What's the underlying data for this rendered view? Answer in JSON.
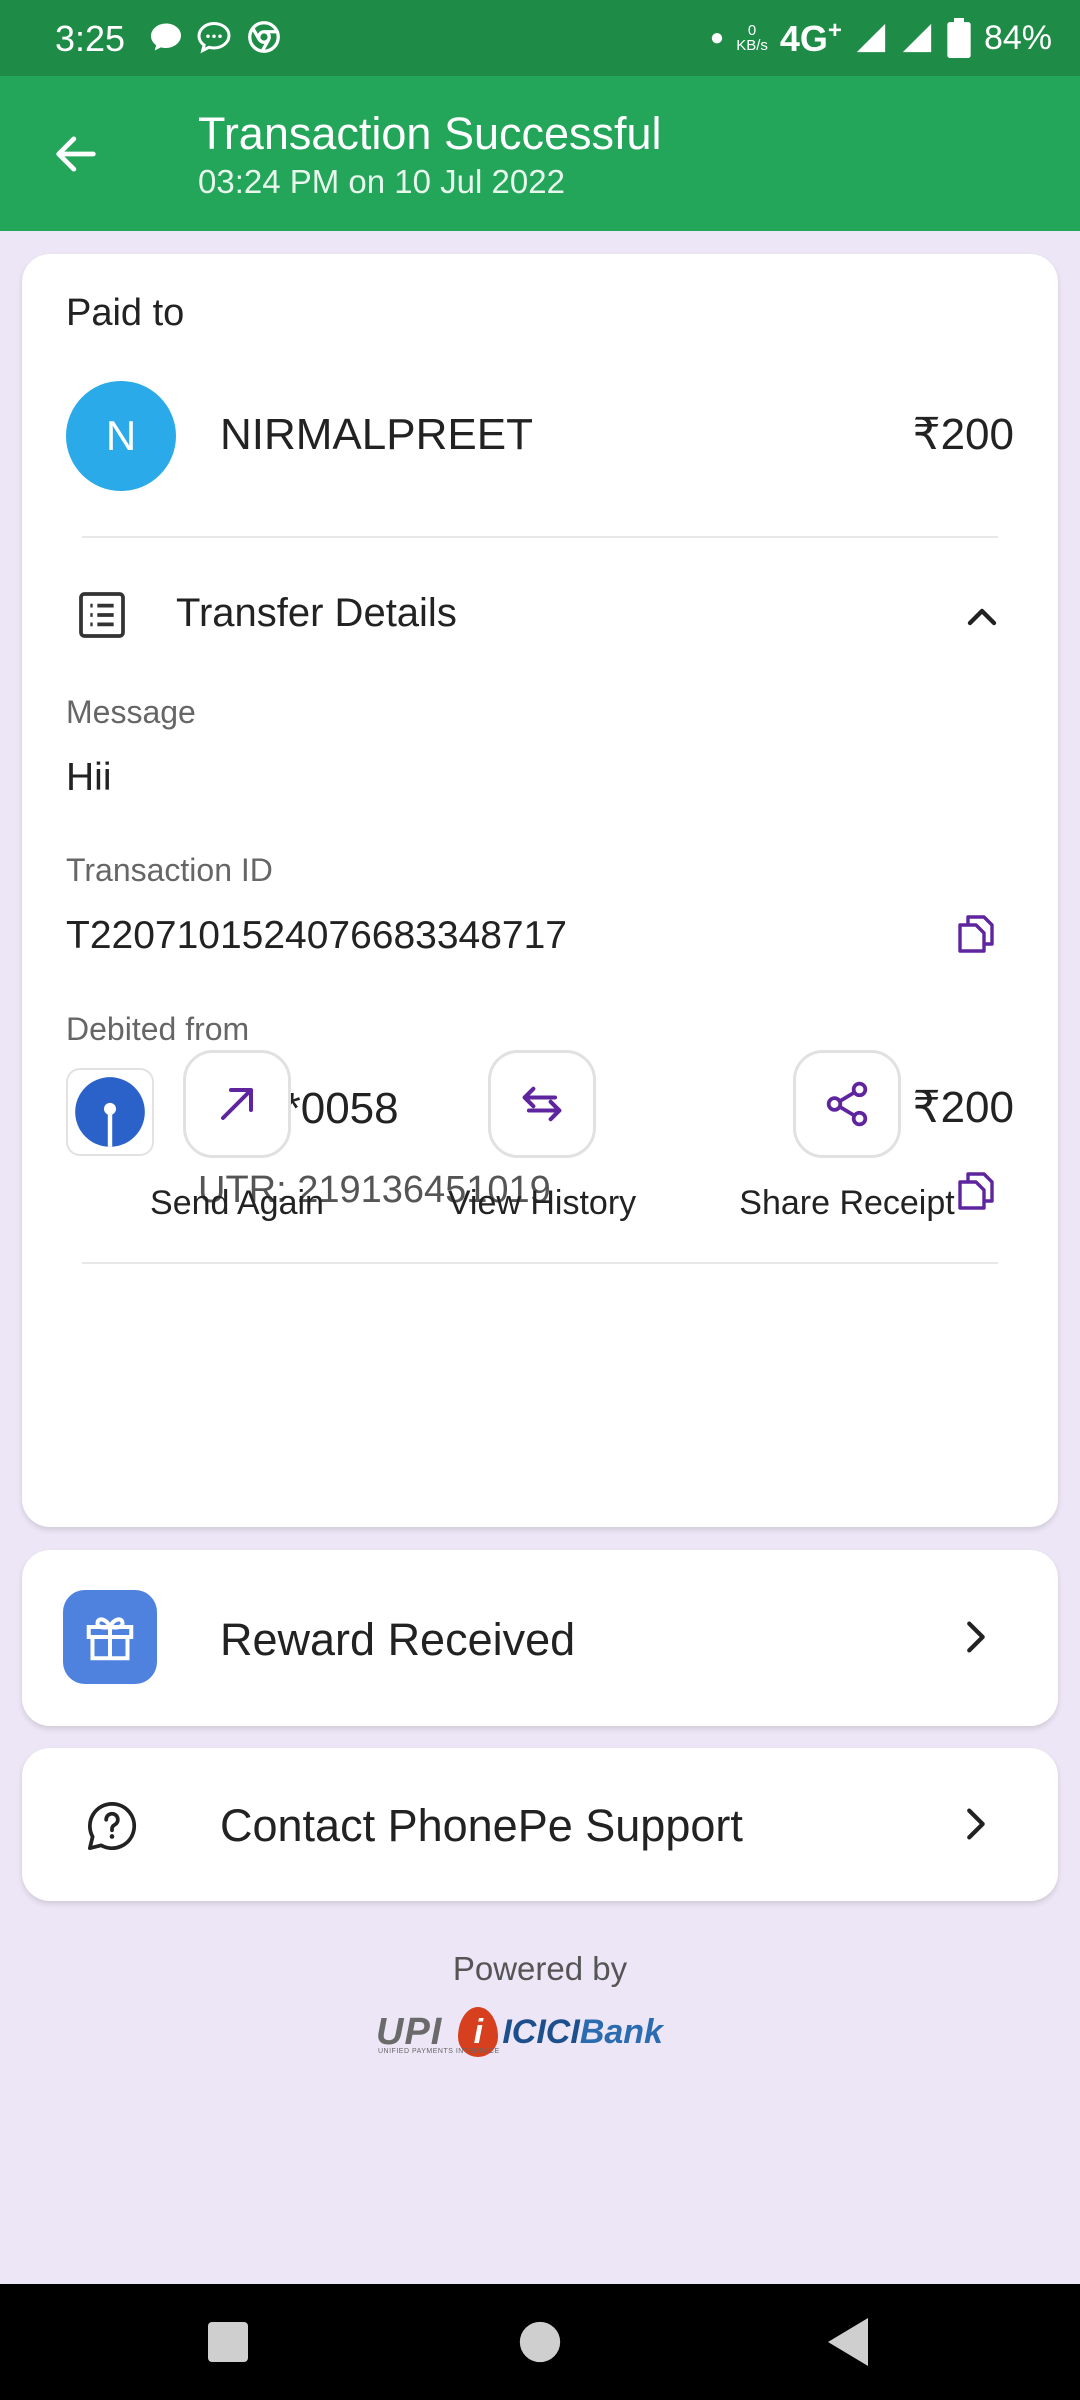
{
  "status_bar": {
    "time": "3:25",
    "net_speed_value": "0",
    "net_speed_unit": "KB/s",
    "network": "4G",
    "network_plus": "+",
    "battery": "84%"
  },
  "header": {
    "title": "Transaction Successful",
    "subtitle": "03:24 PM on 10 Jul 2022"
  },
  "payee": {
    "label": "Paid to",
    "initial": "N",
    "name": "NIRMALPREET",
    "amount": "₹200",
    "avatar_color": "#2aaae8"
  },
  "transfer_details": {
    "title": "Transfer Details",
    "message_label": "Message",
    "message_value": "Hii",
    "txn_id_label": "Transaction ID",
    "txn_id_value": "T2207101524076683348717",
    "debited_label": "Debited from",
    "account_masked": "******0058",
    "debit_amount": "₹200",
    "utr": "UTR: 219136451019"
  },
  "actions": [
    {
      "label": "Send Again",
      "icon": "arrow-up-right-icon"
    },
    {
      "label": "View History",
      "icon": "swap-arrows-icon"
    },
    {
      "label": "Share Receipt",
      "icon": "share-icon"
    }
  ],
  "reward": {
    "label": "Reward Received",
    "icon": "gift-icon"
  },
  "support": {
    "label": "Contact PhonePe Support",
    "icon": "help-chat-icon"
  },
  "footer": {
    "powered_by": "Powered by",
    "upi_logo_text": "UPI",
    "upi_sub_text": "UNIFIED PAYMENTS INTERFACE",
    "icici_text": "ICICI",
    "icici_bank_text": "Bank"
  },
  "colors": {
    "status_bar": "#1e8c47",
    "app_bar": "#23a55a",
    "accent_purple": "#5f259f",
    "background": "#ede6f6",
    "gift_tile": "#4f82df"
  }
}
